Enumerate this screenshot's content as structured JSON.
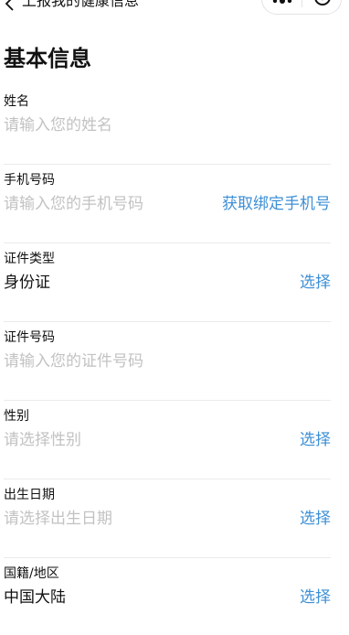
{
  "colors": {
    "accent": "#3d8fd6",
    "placeholder": "#c2c2c2",
    "text": "#111111",
    "divider": "#ebebeb"
  },
  "nav": {
    "back_icon": "chevron-left-icon",
    "title": "上报我的健康信息",
    "more_icon": "more-dots-icon",
    "close_icon": "target-circle-icon"
  },
  "section": {
    "title": "基本信息"
  },
  "form": {
    "name": {
      "label": "姓名",
      "placeholder": "请输入您的姓名"
    },
    "phone": {
      "label": "手机号码",
      "placeholder": "请输入您的手机号码",
      "action": "获取绑定手机号"
    },
    "id_type": {
      "label": "证件类型",
      "value": "身份证",
      "action": "选择"
    },
    "id_number": {
      "label": "证件号码",
      "placeholder": "请输入您的证件号码"
    },
    "gender": {
      "label": "性别",
      "placeholder": "请选择性别",
      "action": "选择"
    },
    "birthdate": {
      "label": "出生日期",
      "placeholder": "请选择出生日期",
      "action": "选择"
    },
    "nationality": {
      "label": "国籍/地区",
      "value": "中国大陆",
      "action": "选择"
    }
  }
}
